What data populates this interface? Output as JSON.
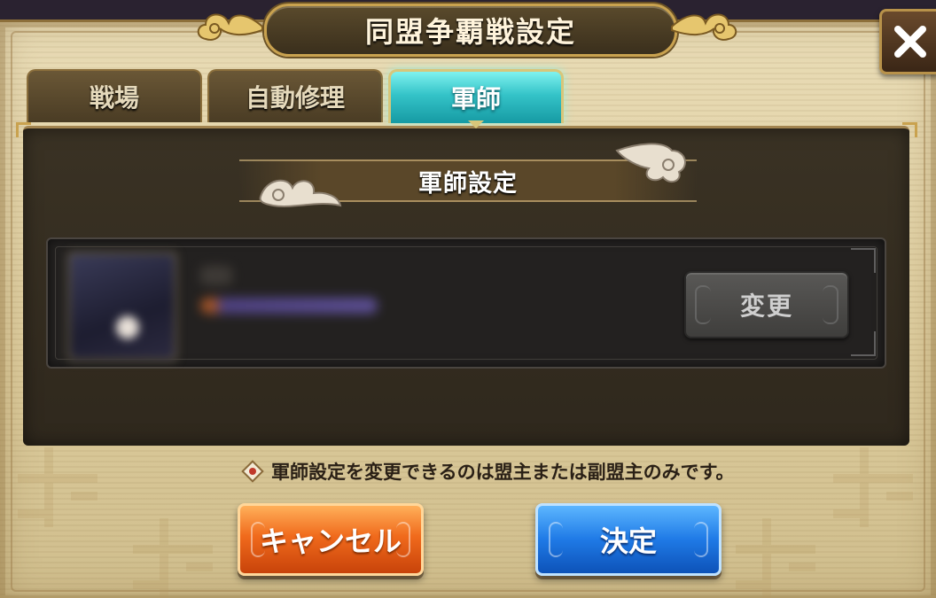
{
  "dialog": {
    "title": "同盟争覇戦設定",
    "close_icon": "close-icon"
  },
  "tabs": [
    {
      "label": "戦場",
      "active": false
    },
    {
      "label": "自動修理",
      "active": false
    },
    {
      "label": "軍師",
      "active": true
    }
  ],
  "section": {
    "title": "軍師設定"
  },
  "strategist_row": {
    "change_label": "変更"
  },
  "notice": {
    "icon": "seal-icon",
    "text": "軍師設定を変更できるのは盟主または副盟主のみです。"
  },
  "actions": {
    "cancel_label": "キャンセル",
    "confirm_label": "決定"
  },
  "colors": {
    "active_tab": "#34c3c8",
    "cancel_button": "#f06a1c",
    "confirm_button": "#1f7ae6",
    "parchment": "#e3d4a8",
    "panel": "#332b1f"
  }
}
